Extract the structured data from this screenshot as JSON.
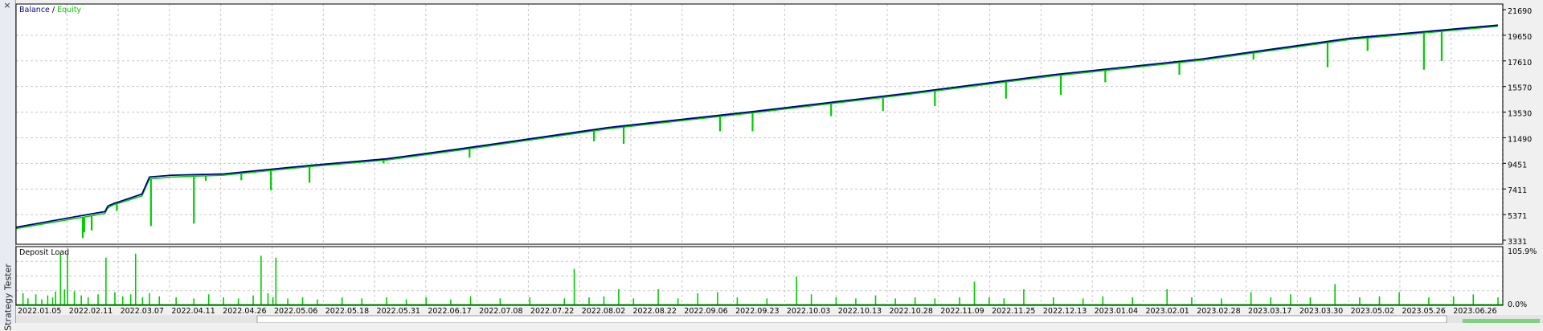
{
  "window": {
    "side_title": "Strategy Tester",
    "close_glyph": "×"
  },
  "colors": {
    "balance": "#00008b",
    "equity": "#00cc00",
    "load": "#00cc00",
    "grid": "#c8c8c8",
    "frame": "#000000"
  },
  "chart_data": [
    {
      "type": "line",
      "title": "",
      "legend": {
        "placement": "top-left",
        "separator": " / "
      },
      "series": [
        {
          "name": "Balance",
          "color": "#00008b"
        },
        {
          "name": "Equity",
          "color": "#00cc00"
        }
      ],
      "ylim": [
        3331,
        21690
      ],
      "yticks": [
        "21690",
        "19650",
        "17610",
        "15570",
        "13530",
        "11490",
        "9451",
        "7411",
        "5371",
        "3331"
      ],
      "xticks": [
        "2022.01.05",
        "2022.02.11",
        "2022.03.07",
        "2022.04.11",
        "2022.04.26",
        "2022.05.06",
        "2022.05.18",
        "2022.05.31",
        "2022.06.17",
        "2022.07.08",
        "2022.07.22",
        "2022.08.02",
        "2022.08.22",
        "2022.09.06",
        "2022.09.23",
        "2022.10.03",
        "2022.10.13",
        "2022.10.28",
        "2022.11.09",
        "2022.11.25",
        "2022.12.13",
        "2023.01.04",
        "2023.02.01",
        "2023.02.28",
        "2023.03.17",
        "2023.03.30",
        "2023.05.02",
        "2023.05.26",
        "2023.06.26"
      ],
      "x": [
        0,
        0.05,
        0.06,
        0.062,
        0.066,
        0.07,
        0.085,
        0.09,
        0.105,
        0.14,
        0.2,
        0.25,
        0.3,
        0.4,
        0.5,
        0.6,
        0.7,
        0.8,
        0.9,
        1.0
      ],
      "balance_values": [
        4550,
        5600,
        5800,
        6250,
        6450,
        6600,
        7200,
        8550,
        8700,
        8800,
        9500,
        10000,
        10800,
        12500,
        13800,
        15200,
        16700,
        17950,
        19600,
        20650
      ],
      "equity_values": [
        4450,
        5450,
        5650,
        6100,
        6350,
        6500,
        7050,
        8400,
        8550,
        8700,
        9400,
        9900,
        10700,
        12400,
        13700,
        15100,
        16600,
        17850,
        19500,
        20550
      ],
      "equity_dips": [
        {
          "x": 0.045,
          "y": 3700
        },
        {
          "x": 0.046,
          "y": 4150
        },
        {
          "x": 0.051,
          "y": 4300
        },
        {
          "x": 0.068,
          "y": 5850
        },
        {
          "x": 0.091,
          "y": 4650
        },
        {
          "x": 0.12,
          "y": 4850
        },
        {
          "x": 0.128,
          "y": 8250
        },
        {
          "x": 0.152,
          "y": 8300
        },
        {
          "x": 0.172,
          "y": 7500
        },
        {
          "x": 0.198,
          "y": 8100
        },
        {
          "x": 0.248,
          "y": 9650
        },
        {
          "x": 0.306,
          "y": 10100
        },
        {
          "x": 0.39,
          "y": 11400
        },
        {
          "x": 0.41,
          "y": 11200
        },
        {
          "x": 0.475,
          "y": 12200
        },
        {
          "x": 0.497,
          "y": 12200
        },
        {
          "x": 0.55,
          "y": 13400
        },
        {
          "x": 0.585,
          "y": 13800
        },
        {
          "x": 0.62,
          "y": 14200
        },
        {
          "x": 0.668,
          "y": 14800
        },
        {
          "x": 0.705,
          "y": 15100
        },
        {
          "x": 0.735,
          "y": 16100
        },
        {
          "x": 0.785,
          "y": 16700
        },
        {
          "x": 0.835,
          "y": 17900
        },
        {
          "x": 0.885,
          "y": 17300
        },
        {
          "x": 0.912,
          "y": 18600
        },
        {
          "x": 0.95,
          "y": 17100
        },
        {
          "x": 0.962,
          "y": 17800
        }
      ]
    },
    {
      "type": "bar",
      "title": "Deposit Load",
      "legend": {
        "placement": "top-left"
      },
      "series": [
        {
          "name": "Deposit Load",
          "color": "#00cc00"
        }
      ],
      "ylim": [
        0,
        105.9
      ],
      "yticks": [
        "105.9%",
        "0.0%"
      ],
      "spikes": [
        {
          "x": 0.007,
          "v": 22
        },
        {
          "x": 0.012,
          "v": 12
        },
        {
          "x": 0.02,
          "v": 20
        },
        {
          "x": 0.026,
          "v": 10
        },
        {
          "x": 0.032,
          "v": 18
        },
        {
          "x": 0.037,
          "v": 14
        },
        {
          "x": 0.04,
          "v": 25
        },
        {
          "x": 0.045,
          "v": 100
        },
        {
          "x": 0.049,
          "v": 30
        },
        {
          "x": 0.052,
          "v": 98
        },
        {
          "x": 0.059,
          "v": 26
        },
        {
          "x": 0.066,
          "v": 18
        },
        {
          "x": 0.073,
          "v": 14
        },
        {
          "x": 0.083,
          "v": 20
        },
        {
          "x": 0.091,
          "v": 92
        },
        {
          "x": 0.1,
          "v": 24
        },
        {
          "x": 0.108,
          "v": 16
        },
        {
          "x": 0.116,
          "v": 20
        },
        {
          "x": 0.121,
          "v": 100
        },
        {
          "x": 0.128,
          "v": 14
        },
        {
          "x": 0.135,
          "v": 22
        },
        {
          "x": 0.145,
          "v": 16
        },
        {
          "x": 0.162,
          "v": 14
        },
        {
          "x": 0.18,
          "v": 12
        },
        {
          "x": 0.195,
          "v": 20
        },
        {
          "x": 0.21,
          "v": 14
        },
        {
          "x": 0.225,
          "v": 12
        },
        {
          "x": 0.24,
          "v": 18
        },
        {
          "x": 0.248,
          "v": 96
        },
        {
          "x": 0.255,
          "v": 22
        },
        {
          "x": 0.26,
          "v": 14
        },
        {
          "x": 0.263,
          "v": 92
        },
        {
          "x": 0.275,
          "v": 12
        },
        {
          "x": 0.29,
          "v": 14
        },
        {
          "x": 0.305,
          "v": 10
        },
        {
          "x": 0.33,
          "v": 14
        },
        {
          "x": 0.35,
          "v": 12
        },
        {
          "x": 0.375,
          "v": 14
        },
        {
          "x": 0.395,
          "v": 10
        },
        {
          "x": 0.415,
          "v": 14
        },
        {
          "x": 0.44,
          "v": 10
        },
        {
          "x": 0.46,
          "v": 16
        },
        {
          "x": 0.49,
          "v": 12
        },
        {
          "x": 0.52,
          "v": 14
        },
        {
          "x": 0.555,
          "v": 12
        },
        {
          "x": 0.565,
          "v": 70
        },
        {
          "x": 0.58,
          "v": 14
        },
        {
          "x": 0.595,
          "v": 16
        },
        {
          "x": 0.61,
          "v": 30
        },
        {
          "x": 0.625,
          "v": 12
        },
        {
          "x": 0.65,
          "v": 30
        },
        {
          "x": 0.67,
          "v": 12
        },
        {
          "x": 0.69,
          "v": 22
        },
        {
          "x": 0.71,
          "v": 24
        },
        {
          "x": 0.73,
          "v": 14
        },
        {
          "x": 0.76,
          "v": 12
        },
        {
          "x": 0.79,
          "v": 55
        },
        {
          "x": 0.805,
          "v": 20
        },
        {
          "x": 0.83,
          "v": 14
        },
        {
          "x": 0.85,
          "v": 12
        },
        {
          "x": 0.87,
          "v": 18
        },
        {
          "x": 0.89,
          "v": 12
        },
        {
          "x": 0.91,
          "v": 14
        },
        {
          "x": 0.93,
          "v": 12
        },
        {
          "x": 0.955,
          "v": 14
        },
        {
          "x": 0.97,
          "v": 45
        },
        {
          "x": 0.985,
          "v": 14
        },
        {
          "x": 1.0,
          "v": 12
        },
        {
          "x": 1.02,
          "v": 30
        },
        {
          "x": 1.05,
          "v": 14
        },
        {
          "x": 1.08,
          "v": 12
        },
        {
          "x": 1.1,
          "v": 16
        },
        {
          "x": 1.13,
          "v": 14
        },
        {
          "x": 1.165,
          "v": 30
        },
        {
          "x": 1.19,
          "v": 14
        },
        {
          "x": 1.22,
          "v": 12
        },
        {
          "x": 1.25,
          "v": 24
        },
        {
          "x": 1.27,
          "v": 14
        },
        {
          "x": 1.29,
          "v": 20
        },
        {
          "x": 1.31,
          "v": 14
        },
        {
          "x": 1.335,
          "v": 40
        },
        {
          "x": 1.36,
          "v": 14
        },
        {
          "x": 1.38,
          "v": 16
        },
        {
          "x": 1.4,
          "v": 24
        },
        {
          "x": 1.43,
          "v": 14
        },
        {
          "x": 1.455,
          "v": 16
        },
        {
          "x": 1.475,
          "v": 20
        },
        {
          "x": 1.5,
          "v": 14
        }
      ]
    }
  ]
}
